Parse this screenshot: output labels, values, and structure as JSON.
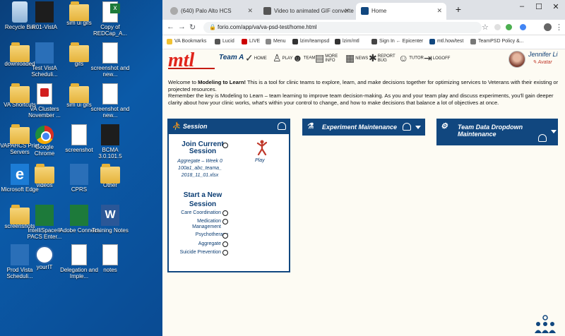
{
  "desktop": {
    "icons": [
      {
        "label": "Recycle Bin",
        "icon": "recycle-bin-icon"
      },
      {
        "label": "R01-VistA",
        "icon": "vista-shortcut-icon"
      },
      {
        "label": "sim ui gifs",
        "icon": "folder-icon"
      },
      {
        "label": "Copy of REDCap_A...",
        "icon": "excel-file-icon"
      },
      {
        "label": "downloaded",
        "icon": "folder-icon"
      },
      {
        "label": "Test VistA Scheduli...",
        "icon": "vista-scheduling-icon"
      },
      {
        "label": "gifs",
        "icon": "folder-icon"
      },
      {
        "label": "screenshot and new...",
        "icon": "image-file-icon"
      },
      {
        "label": "VA Shortcuts",
        "icon": "folder-icon"
      },
      {
        "label": "VA Clusters November ...",
        "icon": "pdf-file-icon"
      },
      {
        "label": "sim ui gifs",
        "icon": "folder-icon"
      },
      {
        "label": "screenshot and new...",
        "icon": "image-file-icon"
      },
      {
        "label": "VAPAHCS Print Servers",
        "icon": "folder-icon"
      },
      {
        "label": "Google Chrome",
        "icon": "chrome-icon"
      },
      {
        "label": "screenshot",
        "icon": "image-file-icon"
      },
      {
        "label": "BCMA 3.0.101.5",
        "icon": "bcma-icon"
      },
      {
        "label": "Microsoft Edge",
        "icon": "edge-icon"
      },
      {
        "label": "videos",
        "icon": "folder-icon"
      },
      {
        "label": "CPRS",
        "icon": "cprs-icon"
      },
      {
        "label": "Other",
        "icon": "folder-icon"
      },
      {
        "label": "screenshots",
        "icon": "folder-icon"
      },
      {
        "label": "IntelliSpace® PACS Enter...",
        "icon": "pacs-icon"
      },
      {
        "label": "Adobe Connect",
        "icon": "adobe-connect-icon"
      },
      {
        "label": "Training Notes",
        "icon": "word-file-icon"
      },
      {
        "label": "Prod Vista Scheduli...",
        "icon": "vista-scheduling-icon"
      },
      {
        "label": "yourIT",
        "icon": "yourit-icon"
      },
      {
        "label": "Delegation and Imple...",
        "icon": "document-icon"
      },
      {
        "label": "notes",
        "icon": "document-icon"
      }
    ]
  },
  "browser": {
    "tabs": [
      {
        "title": "(640) Palo Alto HCS",
        "active": false
      },
      {
        "title": "Video to animated GIF converter",
        "active": false
      },
      {
        "title": "Home",
        "active": true
      }
    ],
    "new_tab": "+",
    "url": "forio.com/app/va/va-psd-test/home.html",
    "bookmarks": [
      "VA Bookmarks",
      "Lucid",
      "LIVE",
      "Menu",
      "lzim/teampsd",
      "lzim/mtl",
      "Sign In ← Epicenter",
      "mtl.how/test",
      "TeamPSD Policy &..."
    ],
    "window_controls": {
      "minimize": "–",
      "maximize": "☐",
      "close": "✕"
    }
  },
  "app": {
    "logo": "mtl",
    "team": "Team A",
    "nav": [
      "HOME",
      "PLAY",
      "TEAM",
      "MORE INFO",
      "NEWS",
      "REPORT BUG",
      "TUTOR",
      "LOGOFF"
    ],
    "user_name": "Jennifer Li",
    "user_avatar_label": "Avatar",
    "intro_bold": "Modeling to Learn!",
    "intro_pre": "Welcome to ",
    "intro_post": " This is a tool for clinic teams to explore, learn, and make decisions together for optimizing services to Veterans with their existing or projected resources.",
    "intro_line2": "Remember the key is Modeling to Learn – team learning to improve team decision-making. As you and your team play and discuss experiments, you'll gain deeper clarity about how your clinic works, what's within your control to change, and how to make decisions that balance a lot of objectives at once.",
    "panels": {
      "session": "Session",
      "experiment": "Experiment Maintenance",
      "team_data": "Team Data Dropdown Maintenance"
    },
    "session": {
      "join_title": "Join Current Session",
      "join_file": "Aggregate – Week 0 100a1_abc_teama_ 2018_11_01.xlsx",
      "play_label": "Play",
      "start_title": "Start a New Session",
      "options": [
        "Care Coordination",
        "Medication Management",
        "Psychotherapy",
        "Aggregate",
        "Suicide Prevention"
      ]
    }
  }
}
